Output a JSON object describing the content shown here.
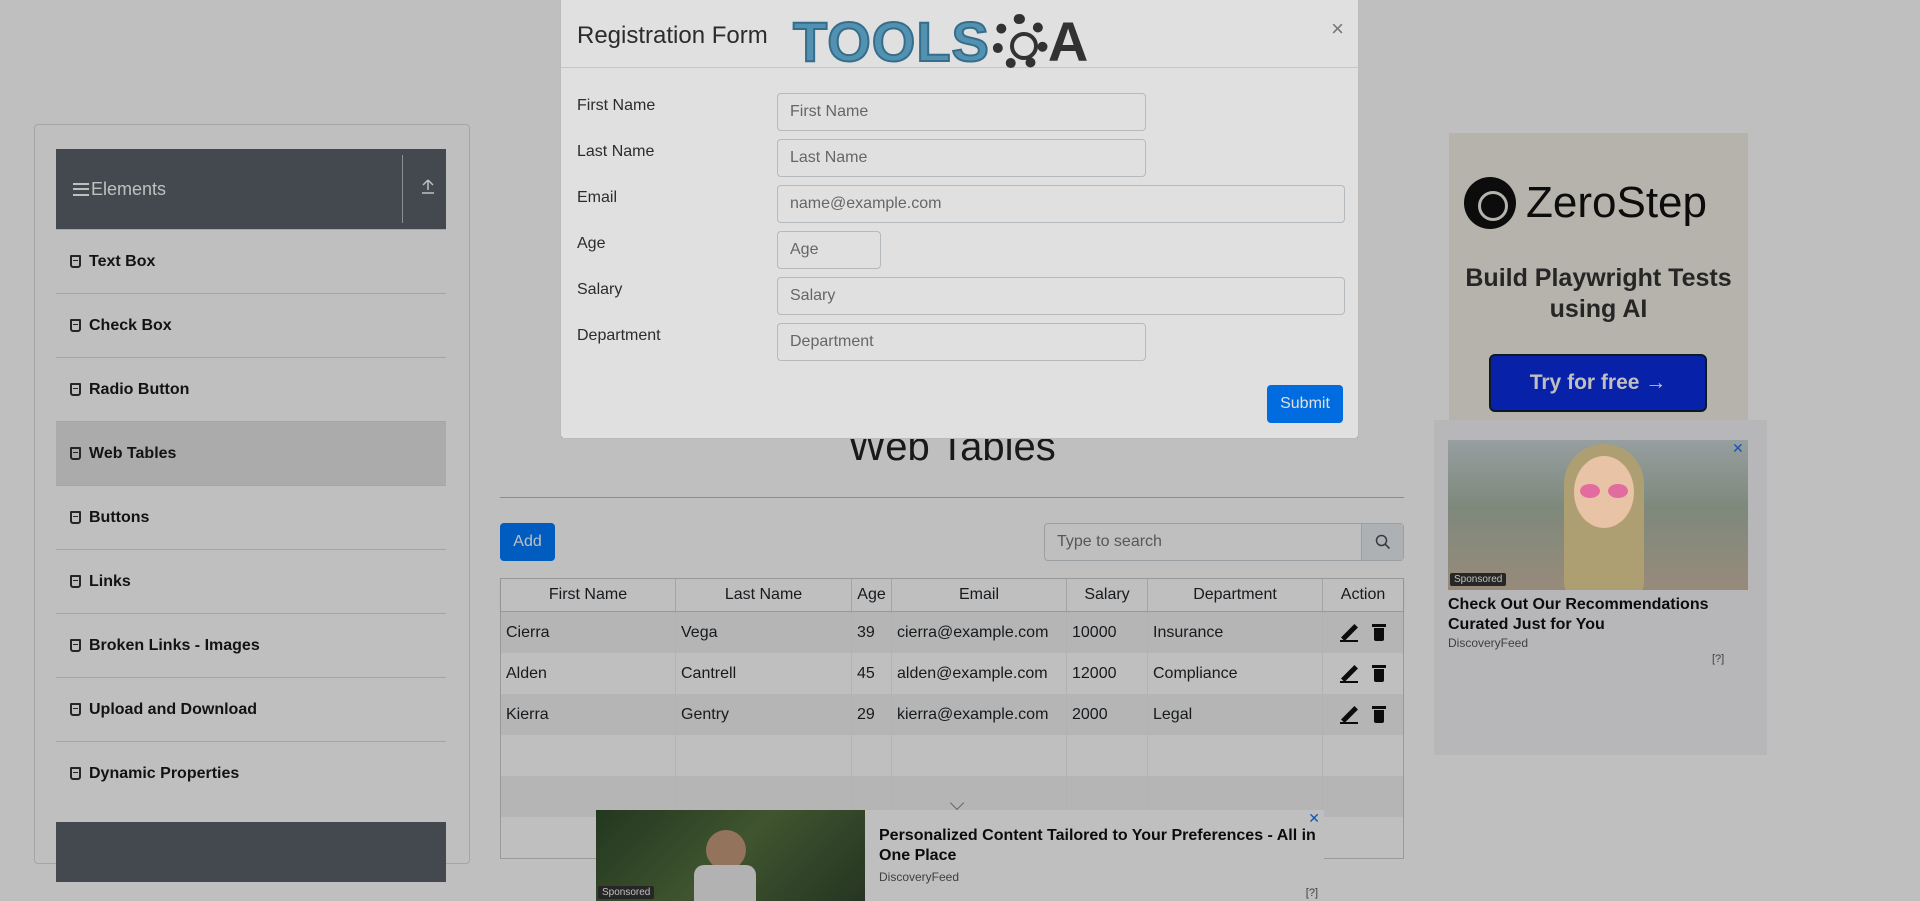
{
  "sidebar": {
    "group_title": "Elements",
    "items": [
      {
        "label": "Text Box"
      },
      {
        "label": "Check Box"
      },
      {
        "label": "Radio Button"
      },
      {
        "label": "Web Tables"
      },
      {
        "label": "Buttons"
      },
      {
        "label": "Links"
      },
      {
        "label": "Broken Links - Images"
      },
      {
        "label": "Upload and Download"
      },
      {
        "label": "Dynamic Properties"
      }
    ],
    "active_index": 3
  },
  "main": {
    "title": "Web Tables",
    "add_label": "Add",
    "search_placeholder": "Type to search"
  },
  "table": {
    "headers": [
      "First Name",
      "Last Name",
      "Age",
      "Email",
      "Salary",
      "Department",
      "Action"
    ],
    "rows": [
      [
        "Cierra",
        "Vega",
        "39",
        "cierra@example.com",
        "10000",
        "Insurance"
      ],
      [
        "Alden",
        "Cantrell",
        "45",
        "alden@example.com",
        "12000",
        "Compliance"
      ],
      [
        "Kierra",
        "Gentry",
        "29",
        "kierra@example.com",
        "2000",
        "Legal"
      ]
    ]
  },
  "modal": {
    "title": "Registration Form",
    "close": "×",
    "logo_text": "TOOLS",
    "logo_suffix": "A",
    "fields": [
      {
        "label": "First Name",
        "placeholder": "First Name"
      },
      {
        "label": "Last Name",
        "placeholder": "Last Name"
      },
      {
        "label": "Email",
        "placeholder": "name@example.com"
      },
      {
        "label": "Age",
        "placeholder": "Age"
      },
      {
        "label": "Salary",
        "placeholder": "Salary"
      },
      {
        "label": "Department",
        "placeholder": "Department"
      }
    ],
    "submit_label": "Submit"
  },
  "ads": {
    "zerostep": {
      "brand": "ZeroStep",
      "tagline": "Build Playwright Tests using AI",
      "cta": "Try for free →"
    },
    "discovery": {
      "sponsored": "Sponsored",
      "headline": "Check Out Our Recommendations Curated Just for You",
      "source": "DiscoveryFeed",
      "close": "✕",
      "help": "[?]"
    },
    "bottom": {
      "sponsored": "Sponsored",
      "headline": "Personalized Content Tailored to Your Preferences - All in One Place",
      "source": "DiscoveryFeed",
      "close": "✕",
      "help": "[?]"
    }
  },
  "colors": {
    "primary": "#007bff",
    "sidebar_header": "#5a6268"
  }
}
